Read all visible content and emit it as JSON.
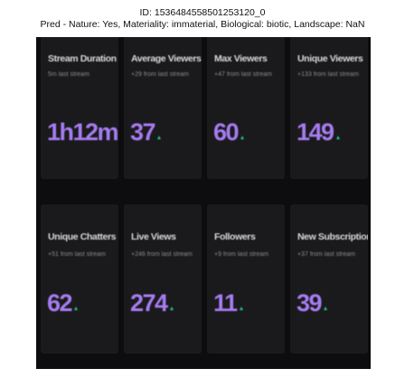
{
  "header": {
    "id_line": "ID: 1536484558501253120_0",
    "pred_line": "Pred - Nature: Yes, Materiality: immaterial, Biological: biotic, Landscape: NaN"
  },
  "stats": [
    {
      "title": "Stream Duration",
      "sub": "5m last stream",
      "value": "1h12m",
      "trend_icon": ""
    },
    {
      "title": "Average Viewers",
      "sub": "+29 from last stream",
      "value": "37",
      "trend_icon": "arrow-up-icon"
    },
    {
      "title": "Max Viewers",
      "sub": "+47 from last stream",
      "value": "60",
      "trend_icon": "arrow-up-icon"
    },
    {
      "title": "Unique Viewers",
      "sub": "+133 from last stream",
      "value": "149",
      "trend_icon": "arrow-up-icon"
    },
    {
      "title": "Unique Chatters",
      "sub": "+51 from last stream",
      "value": "62",
      "trend_icon": "arrow-up-icon"
    },
    {
      "title": "Live Views",
      "sub": "+246 from last stream",
      "value": "274",
      "trend_icon": "arrow-up-icon"
    },
    {
      "title": "Followers",
      "sub": "+9 from last stream",
      "value": "11",
      "trend_icon": "arrow-up-icon"
    },
    {
      "title": "New Subscriptions",
      "sub": "+37 from last stream",
      "value": "39",
      "trend_icon": "arrow-up-icon"
    }
  ],
  "colors": {
    "value_purple": "#a77cf0",
    "trend_green": "#22c28a",
    "card_bg": "#1a1a1d",
    "page_bg": "#0d0d0f"
  }
}
